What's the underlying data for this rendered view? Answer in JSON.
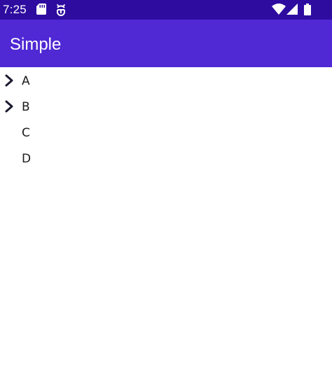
{
  "status_bar": {
    "time": "7:25",
    "left_icons": [
      "sd-card-icon",
      "debug-icon"
    ],
    "right_icons": [
      "wifi-icon",
      "signal-icon",
      "battery-icon"
    ],
    "color": "#2e0ca0"
  },
  "app_bar": {
    "title": "Simple",
    "color": "#5028d4"
  },
  "tree": {
    "items": [
      {
        "label": "A",
        "expandable": true
      },
      {
        "label": "B",
        "expandable": true
      },
      {
        "label": "C",
        "expandable": false
      },
      {
        "label": "D",
        "expandable": false
      }
    ]
  }
}
